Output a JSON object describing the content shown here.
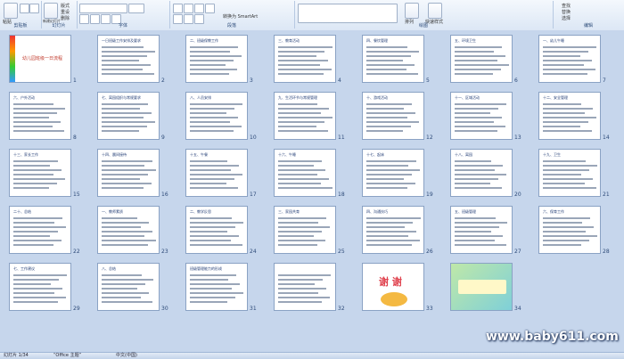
{
  "ribbon": {
    "groups": [
      "剪贴板",
      "幻灯片",
      "字体",
      "段落",
      "绘图",
      "编辑"
    ],
    "buttons": {
      "paste": "粘贴",
      "new_slide": "新建幻灯片",
      "layout": "版式",
      "reset": "重设",
      "delete": "删除",
      "find": "查找",
      "replace": "替换",
      "select": "选择",
      "arrange": "排列",
      "quick_styles": "快速样式",
      "convert_smartart": "转换为 SmartArt"
    }
  },
  "slides": [
    {
      "n": "1",
      "title": "幼儿园班级一日流程",
      "kind": "title"
    },
    {
      "n": "2",
      "title": "一日班级工作安排及要求",
      "kind": "text"
    },
    {
      "n": "3",
      "title": "二、班级保教工作",
      "kind": "text"
    },
    {
      "n": "4",
      "title": "三、教育活动",
      "kind": "text"
    },
    {
      "n": "5",
      "title": "四、餐饮管理",
      "kind": "text"
    },
    {
      "n": "6",
      "title": "五、环境卫生",
      "kind": "text"
    },
    {
      "n": "7",
      "title": "一、幼儿午睡",
      "kind": "text"
    },
    {
      "n": "8",
      "title": "六、户外活动",
      "kind": "text"
    },
    {
      "n": "9",
      "title": "七、离园组织与常规要求",
      "kind": "text"
    },
    {
      "n": "10",
      "title": "八、人员安排",
      "kind": "text"
    },
    {
      "n": "11",
      "title": "九、生活环节与常规管理",
      "kind": "text"
    },
    {
      "n": "12",
      "title": "十、游戏活动",
      "kind": "text"
    },
    {
      "n": "13",
      "title": "十一、区域活动",
      "kind": "text"
    },
    {
      "n": "14",
      "title": "十二、安全管理",
      "kind": "text"
    },
    {
      "n": "15",
      "title": "十三、家长工作",
      "kind": "text"
    },
    {
      "n": "16",
      "title": "十四、晨间接待",
      "kind": "text"
    },
    {
      "n": "17",
      "title": "十五、午餐",
      "kind": "text"
    },
    {
      "n": "18",
      "title": "十六、午睡",
      "kind": "text"
    },
    {
      "n": "19",
      "title": "十七、起床",
      "kind": "text"
    },
    {
      "n": "20",
      "title": "十八、离园",
      "kind": "text"
    },
    {
      "n": "21",
      "title": "十九、卫生",
      "kind": "text"
    },
    {
      "n": "22",
      "title": "二十、总结",
      "kind": "text"
    },
    {
      "n": "23",
      "title": "一、教师素质",
      "kind": "text"
    },
    {
      "n": "24",
      "title": "二、教学反思",
      "kind": "text"
    },
    {
      "n": "25",
      "title": "三、家园共育",
      "kind": "text"
    },
    {
      "n": "26",
      "title": "四、沟通技巧",
      "kind": "text"
    },
    {
      "n": "27",
      "title": "五、班级管理",
      "kind": "text"
    },
    {
      "n": "28",
      "title": "六、保育工作",
      "kind": "text"
    },
    {
      "n": "29",
      "title": "七、工作建议",
      "kind": "text"
    },
    {
      "n": "30",
      "title": "八、总结",
      "kind": "text"
    },
    {
      "n": "31",
      "title": "班级管理能力的形成",
      "kind": "text"
    },
    {
      "n": "32",
      "title": "",
      "kind": "text"
    },
    {
      "n": "33",
      "title": "谢 谢",
      "kind": "thanks"
    },
    {
      "n": "34",
      "title": "",
      "kind": "green"
    }
  ],
  "status": {
    "slide": "幻灯片 1/34",
    "theme": "“Office 主题”",
    "lang": "中文(中国)"
  },
  "watermark": "www.baby611.com"
}
